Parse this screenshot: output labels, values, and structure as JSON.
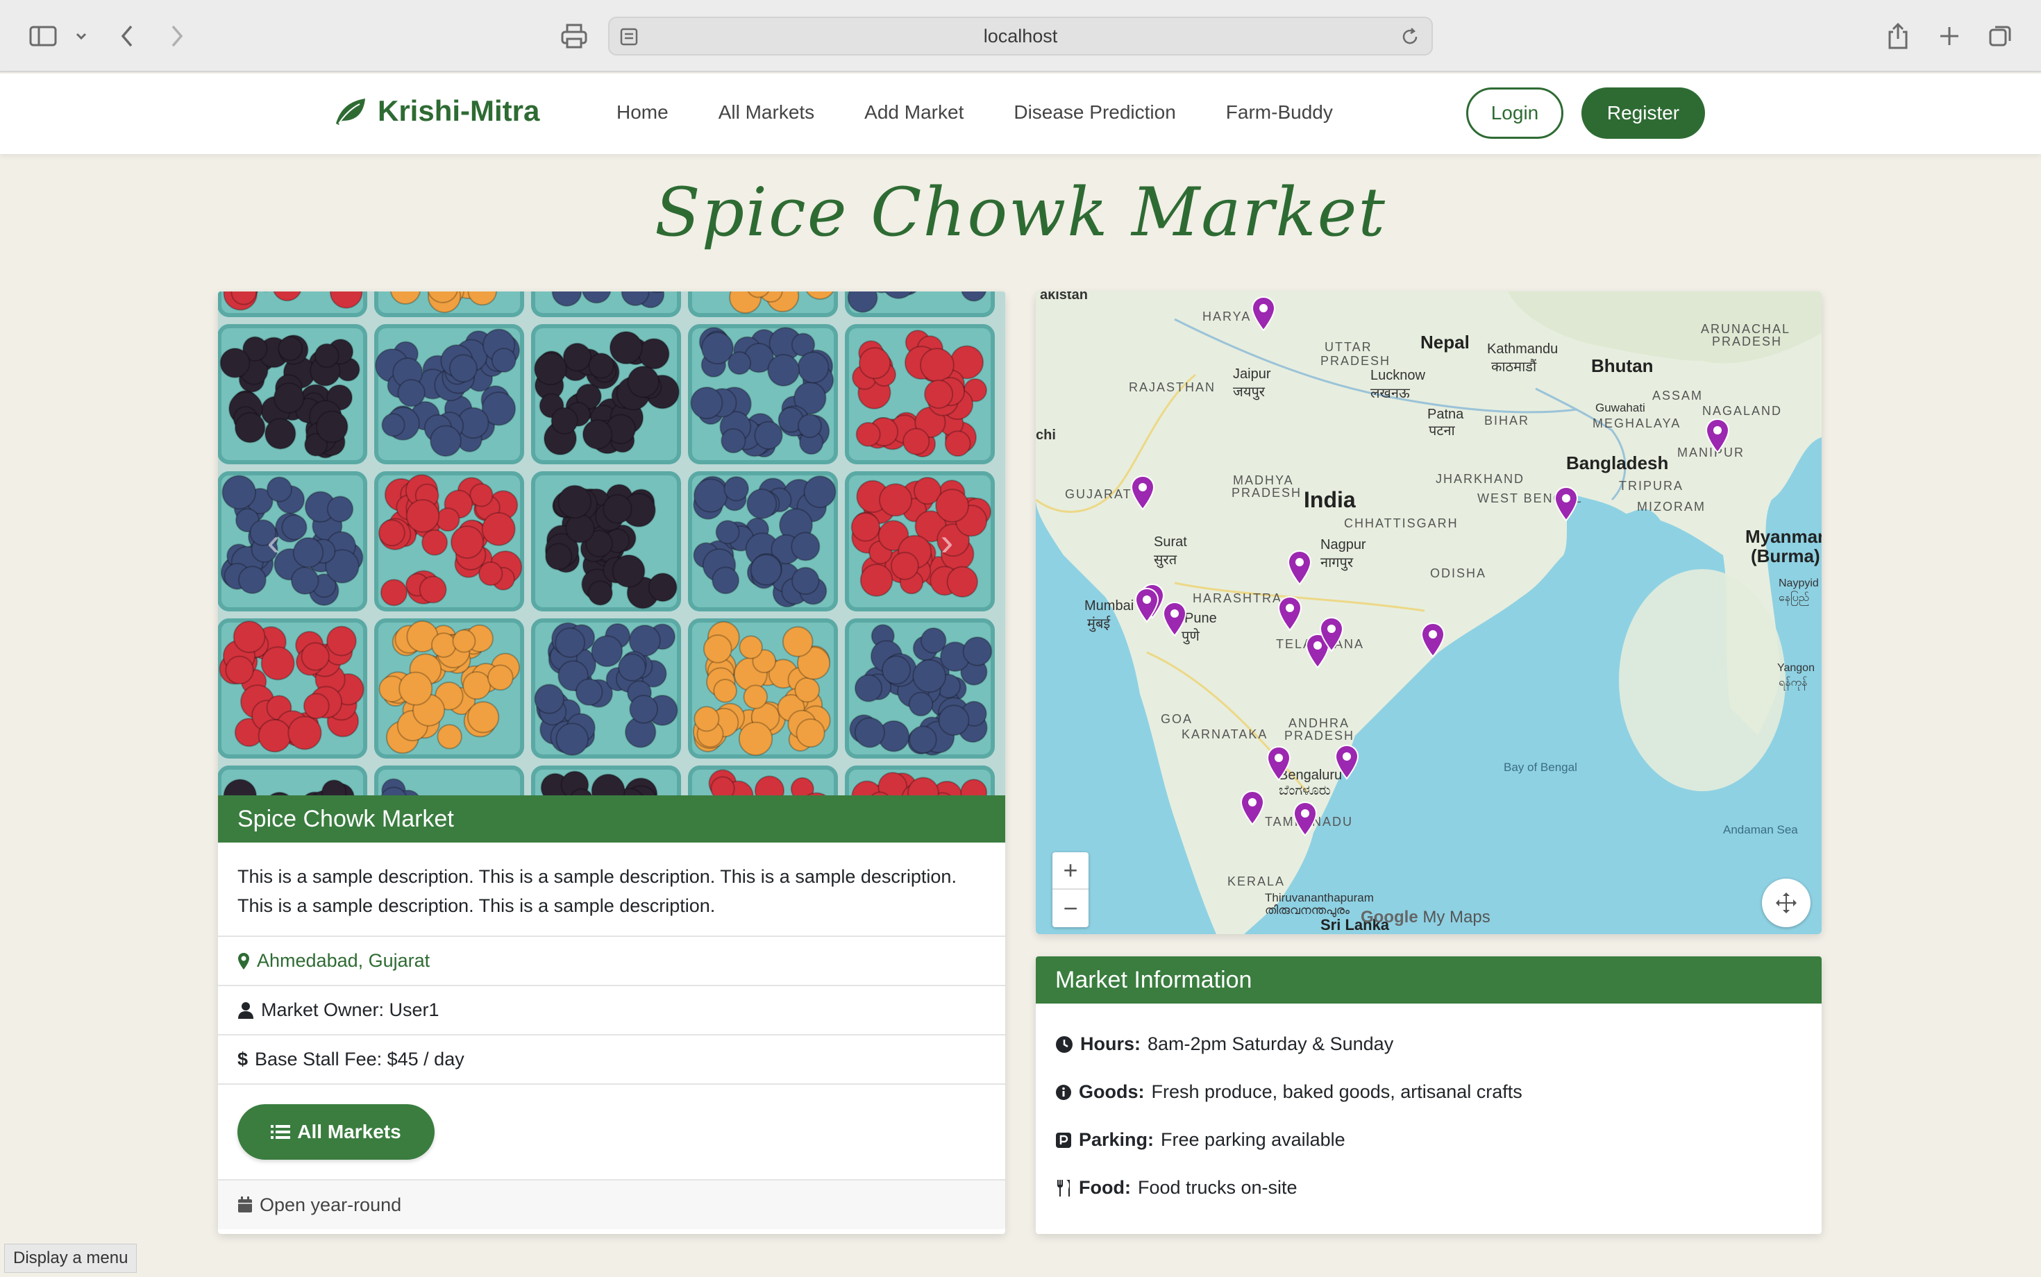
{
  "browser": {
    "url": "localhost"
  },
  "navbar": {
    "brand": "Krishi-Mitra",
    "links": [
      "Home",
      "All Markets",
      "Add Market",
      "Disease Prediction",
      "Farm-Buddy"
    ],
    "login_label": "Login",
    "register_label": "Register"
  },
  "page": {
    "title": "Spice Chowk Market"
  },
  "market_card": {
    "header": "Spice Chowk Market",
    "description": "This is a sample description. This is a sample description. This is a sample description. This is a sample description. This is a sample description.",
    "location": "Ahmedabad, Gujarat",
    "owner": "Market Owner: User1",
    "fee": "Base Stall Fee: $45 / day",
    "all_markets_label": "All Markets",
    "footer": "Open year-round"
  },
  "map": {
    "labels": {
      "pakistan": "akistan",
      "haryana": "HARYA",
      "uttar_pradesh_1": "UTTAR",
      "uttar_pradesh_2": "PRADESH",
      "nepal": "Nepal",
      "kathmandu": "Kathmandu",
      "kathmandu_local": "काठमाडौं",
      "bhutan": "Bhutan",
      "arunachal_1": "ARUNACHAL",
      "arunachal_2": "PRADESH",
      "rajasthan": "RAJASTHAN",
      "jaipur": "Jaipur",
      "jaipur_local": "जयपुर",
      "lucknow": "Lucknow",
      "lucknow_local": "लखनऊ",
      "assam": "ASSAM",
      "guwahati": "Guwahati",
      "meghalaya": "MEGHALAYA",
      "nagaland": "NAGALAND",
      "patna": "Patna",
      "patna_local": "पटना",
      "bihar": "BIHAR",
      "chi": "chi",
      "manipur": "MANIPUR",
      "bangladesh": "Bangladesh",
      "gujarat": "GUJARAT",
      "madhya_1": "MADHYA",
      "madhya_2": "PRADESH",
      "india": "India",
      "jharkhand": "JHARKHAND",
      "west_bengal": "WEST BENGAL",
      "tripura": "TRIPURA",
      "mizoram": "MIZORAM",
      "chhattisgarh": "CHHATTISGARH",
      "myanmar": "Myanmar",
      "burma": "(Burma)",
      "surat": "Surat",
      "surat_local": "सुरत",
      "nagpur": "Nagpur",
      "nagpur_local": "नागपुर",
      "odisha": "ODISHA",
      "naypyidaw": "Naypyid",
      "naypyidaw_local": "နေပြည်",
      "maharashtra": "HARASHTRA",
      "mumbai": "Mumbai",
      "mumbai_local": "मुंबई",
      "pune": "Pune",
      "pune_local": "पुणे",
      "telangana": "TELANGANA",
      "yangon": "Yangon",
      "yangon_local": "ရန်ကုန်",
      "goa": "GOA",
      "andhra_1": "ANDHRA",
      "andhra_2": "PRADESH",
      "karnataka": "KARNATAKA",
      "bay_of_bengal": "Bay of Bengal",
      "bengaluru": "Bengaluru",
      "bengaluru_local": "ಬೆಂಗಳೂರು",
      "tamil_nadu": "TAMIL NADU",
      "andaman_sea": "Andaman Sea",
      "kerala": "KERALA",
      "thiruvananthapuram": "Thiruvananthapuram",
      "thiruvananthapuram_local": "തിരുവനന്തപുരം",
      "sri_lanka": "Sri Lanka"
    },
    "attribution": "Google",
    "my_maps": "My Maps",
    "zoom_in": "+",
    "zoom_out": "−",
    "marker_color": "#9c27b0"
  },
  "market_info": {
    "header": "Market Information",
    "rows": [
      {
        "label": "Hours:",
        "value": "8am-2pm Saturday & Sunday",
        "icon": "clock-icon"
      },
      {
        "label": "Goods:",
        "value": "Fresh produce, baked goods, artisanal crafts",
        "icon": "info-icon"
      },
      {
        "label": "Parking:",
        "value": "Free parking available",
        "icon": "parking-icon"
      },
      {
        "label": "Food:",
        "value": "Food trucks on-site",
        "icon": "utensils-icon"
      }
    ]
  },
  "status_tip": "Display a menu",
  "colors": {
    "brand_green": "#2e6b33",
    "header_green": "#3a7d3f",
    "page_bg": "#f1efe6"
  }
}
